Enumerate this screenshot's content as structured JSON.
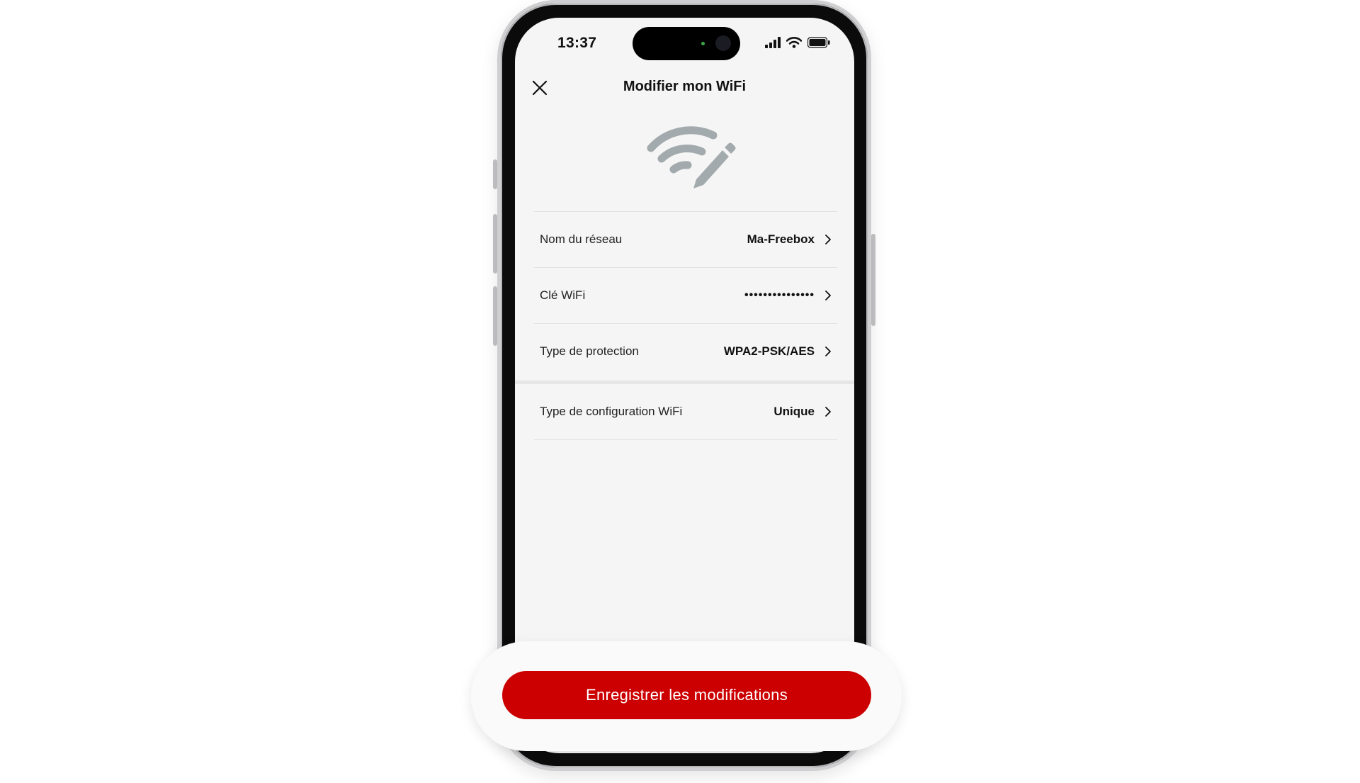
{
  "status_bar": {
    "time": "13:37"
  },
  "header": {
    "title": "Modifier mon WiFi"
  },
  "colors": {
    "accent": "#cc0000",
    "icon_gray": "#a3aaad",
    "background": "#f5f5f5"
  },
  "settings": [
    {
      "label": "Nom du réseau",
      "value": "Ma-Freebox"
    },
    {
      "label": "Clé WiFi",
      "value": "•••••••••••••••"
    },
    {
      "label": "Type de protection",
      "value": "WPA2-PSK/AES"
    }
  ],
  "config": {
    "label": "Type de configuration WiFi",
    "value": "Unique"
  },
  "footer": {
    "save_label": "Enregistrer les modifications"
  },
  "icons": {
    "close": "close-icon",
    "hero": "wifi-edit-icon",
    "chevron": "chevron-right-icon"
  }
}
